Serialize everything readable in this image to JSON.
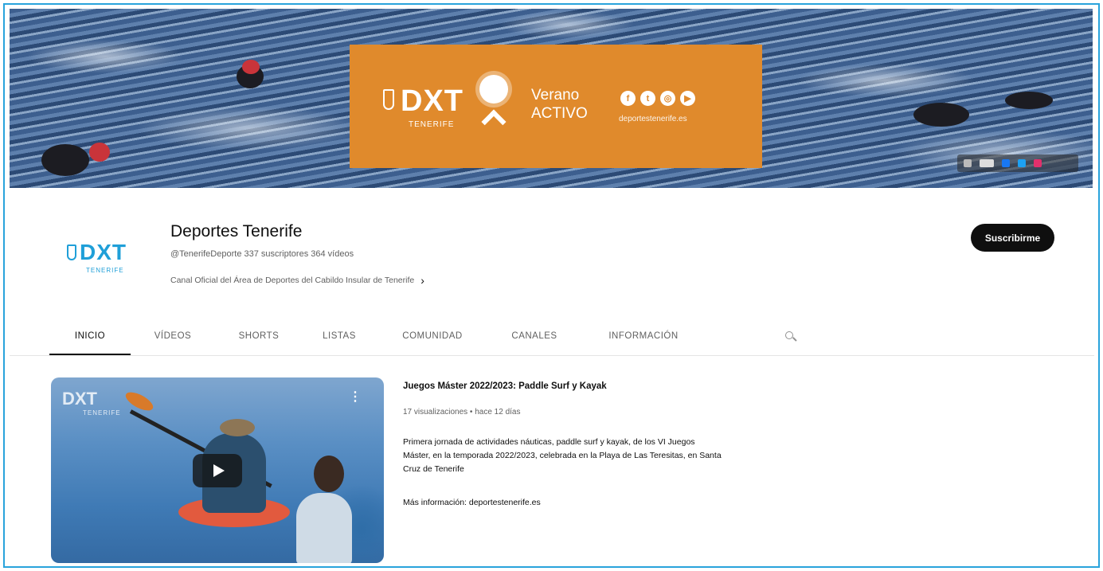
{
  "banner": {
    "logo_text": "DXT",
    "logo_sub": "TENERIFE",
    "verano_line1": "Verano",
    "verano_line2": "ACTIVO",
    "social_icons": [
      "facebook-icon",
      "twitter-icon",
      "instagram-icon",
      "youtube-icon"
    ],
    "site": "deportestenerife.es",
    "accent_color": "#e08a2c"
  },
  "channel": {
    "avatar_text": "DXT",
    "avatar_sub": "TENERIFE",
    "name": "Deportes Tenerife",
    "meta": "@TenerifeDeporte  337 suscriptores  364 vídeos",
    "description": "Canal Oficial del Área de Deportes del Cabildo Insular de Tenerife",
    "subscribe_label": "Suscribirme"
  },
  "tabs": [
    "INICIO",
    "VÍDEOS",
    "SHORTS",
    "LISTAS",
    "COMUNIDAD",
    "CANALES",
    "INFORMACIÓN"
  ],
  "video": {
    "thumb_logo": "DXT",
    "thumb_sub": "TENERIFE",
    "title": "Juegos Máster 2022/2023: Paddle Surf y Kayak",
    "meta": "17 visualizaciones • hace 12 días",
    "description": "Primera jornada de actividades náuticas, paddle surf y kayak, de los VI Juegos Máster, en la temporada 2022/2023, celebrada en la Playa de Las Teresitas, en Santa Cruz de Tenerife",
    "more": "Más información: deportestenerife.es"
  }
}
